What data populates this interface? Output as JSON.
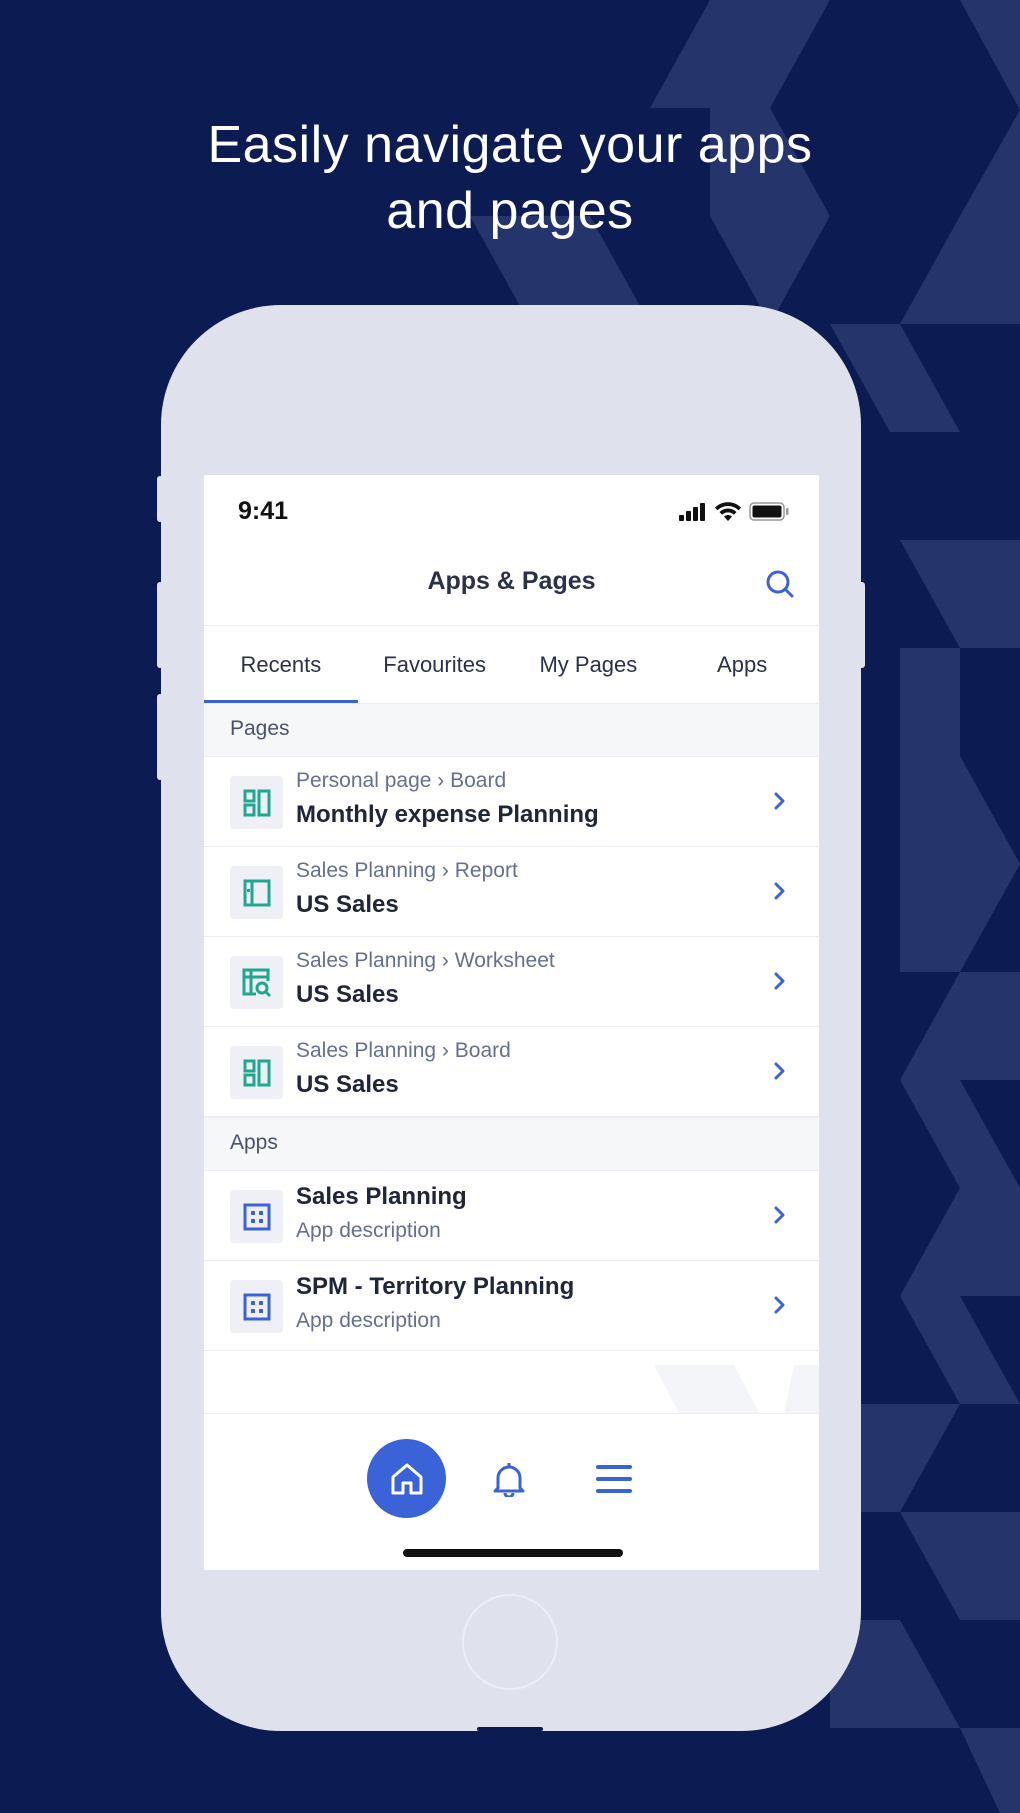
{
  "headline": {
    "line1": "Easily navigate your apps",
    "line2": "and pages"
  },
  "status_bar": {
    "time": "9:41"
  },
  "nav": {
    "title": "Apps & Pages",
    "search_icon": "search-icon"
  },
  "tabs": [
    {
      "label": "Recents",
      "active": true
    },
    {
      "label": "Favourites",
      "active": false
    },
    {
      "label": "My Pages",
      "active": false
    },
    {
      "label": "Apps",
      "active": false
    }
  ],
  "pages_section": {
    "label": "Pages",
    "items": [
      {
        "path": "Personal page › Board",
        "title": "Monthly expense Planning",
        "icon": "board-icon"
      },
      {
        "path": "Sales Planning › Report",
        "title": "US Sales",
        "icon": "report-icon"
      },
      {
        "path": "Sales Planning › Worksheet",
        "title": "US Sales",
        "icon": "worksheet-icon"
      },
      {
        "path": "Sales Planning › Board",
        "title": "US Sales",
        "icon": "board-icon"
      }
    ]
  },
  "apps_section": {
    "label": "Apps",
    "items": [
      {
        "title": "Sales Planning",
        "description": "App description",
        "icon": "app-grid-icon"
      },
      {
        "title": "SPM - Territory Planning",
        "description": "App description",
        "icon": "app-grid-icon"
      }
    ]
  },
  "bottom_nav": {
    "home_icon": "home-icon",
    "notifications_icon": "bell-icon",
    "menu_icon": "hamburger-menu-icon"
  },
  "colors": {
    "background": "#0c1b52",
    "accent": "#3a63d8",
    "teal_icon": "#1fa88f",
    "phone_body": "#dfe2ec"
  }
}
